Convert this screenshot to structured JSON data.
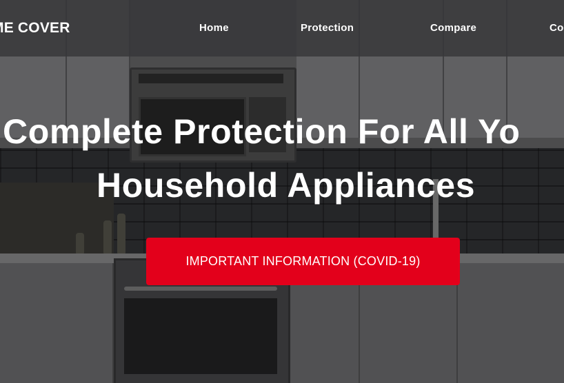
{
  "header": {
    "logo_text": "ME COVER",
    "nav": [
      {
        "label": "Home"
      },
      {
        "label": "Protection"
      },
      {
        "label": "Compare"
      },
      {
        "label": "Co"
      }
    ]
  },
  "hero": {
    "title_line1": "Complete Protection For All Yo",
    "title_line2": "Household Appliances",
    "cta_label": "IMPORTANT INFORMATION (COVID-19)"
  },
  "colors": {
    "cta_background": "#e3001b",
    "header_background": "#373739",
    "text": "#ffffff"
  }
}
